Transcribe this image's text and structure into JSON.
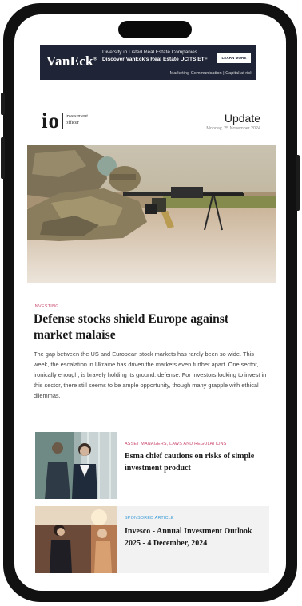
{
  "ad": {
    "brand": "VanEck",
    "line1": "Diversify in Listed Real Estate Companies",
    "line2": "Discover VanEck's Real Estate UCITS ETF",
    "cta": "LEARN MORE",
    "footer": "Marketing Communication | Capital at risk"
  },
  "masthead": {
    "logo": "io",
    "wordmark_line1": "investment",
    "wordmark_line2": "officer",
    "edition": "Update",
    "date": "Monday, 25 November 2024"
  },
  "lead_article": {
    "kicker": "INVESTING",
    "headline": "Defense stocks shield Europe against market malaise",
    "summary": "The gap between the US and European stock markets has rarely been so wide. This week, the escalation in Ukraine has driven the markets even further apart. One sector, ironically enough, is bravely holding its ground: defense. For investors looking to invest in this sector, there still seems to be ample opportunity, though many grapple with ethical dilemmas."
  },
  "articles": [
    {
      "kicker": "ASSET MANAGERS, LAWS AND REGULATIONS",
      "title": "Esma chief cautions on risks of simple investment product"
    },
    {
      "kicker": "SPONSORED ARTICLE",
      "title": "Invesco - Annual Investment Outlook 2025 - 4 December, 2024"
    }
  ],
  "colors": {
    "accent_red": "#c8456a",
    "sponsored_blue": "#3a9ad6",
    "ad_navy": "#1f2537",
    "phone_frame": "#111111"
  }
}
